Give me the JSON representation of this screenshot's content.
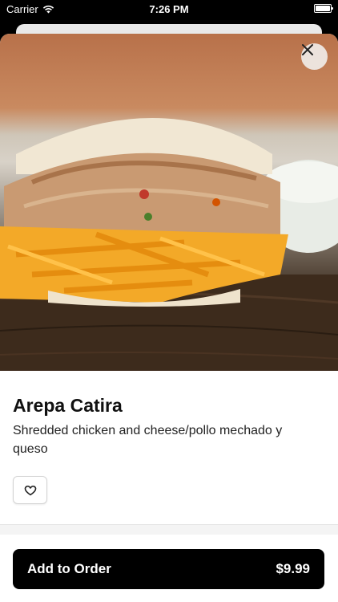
{
  "status_bar": {
    "carrier": "Carrier",
    "time": "7:26 PM"
  },
  "item": {
    "name": "Arepa Catira",
    "description": "Shredded chicken and cheese/pollo mechado y queso",
    "image_alt": "Arepa filled with shredded chicken and cheddar cheese"
  },
  "actions": {
    "close_icon": "close-icon",
    "favorite_icon": "heart-outline-icon",
    "add_label": "Add to Order",
    "price": "$9.99"
  },
  "colors": {
    "primary_button": "#000000",
    "background": "#ffffff"
  }
}
